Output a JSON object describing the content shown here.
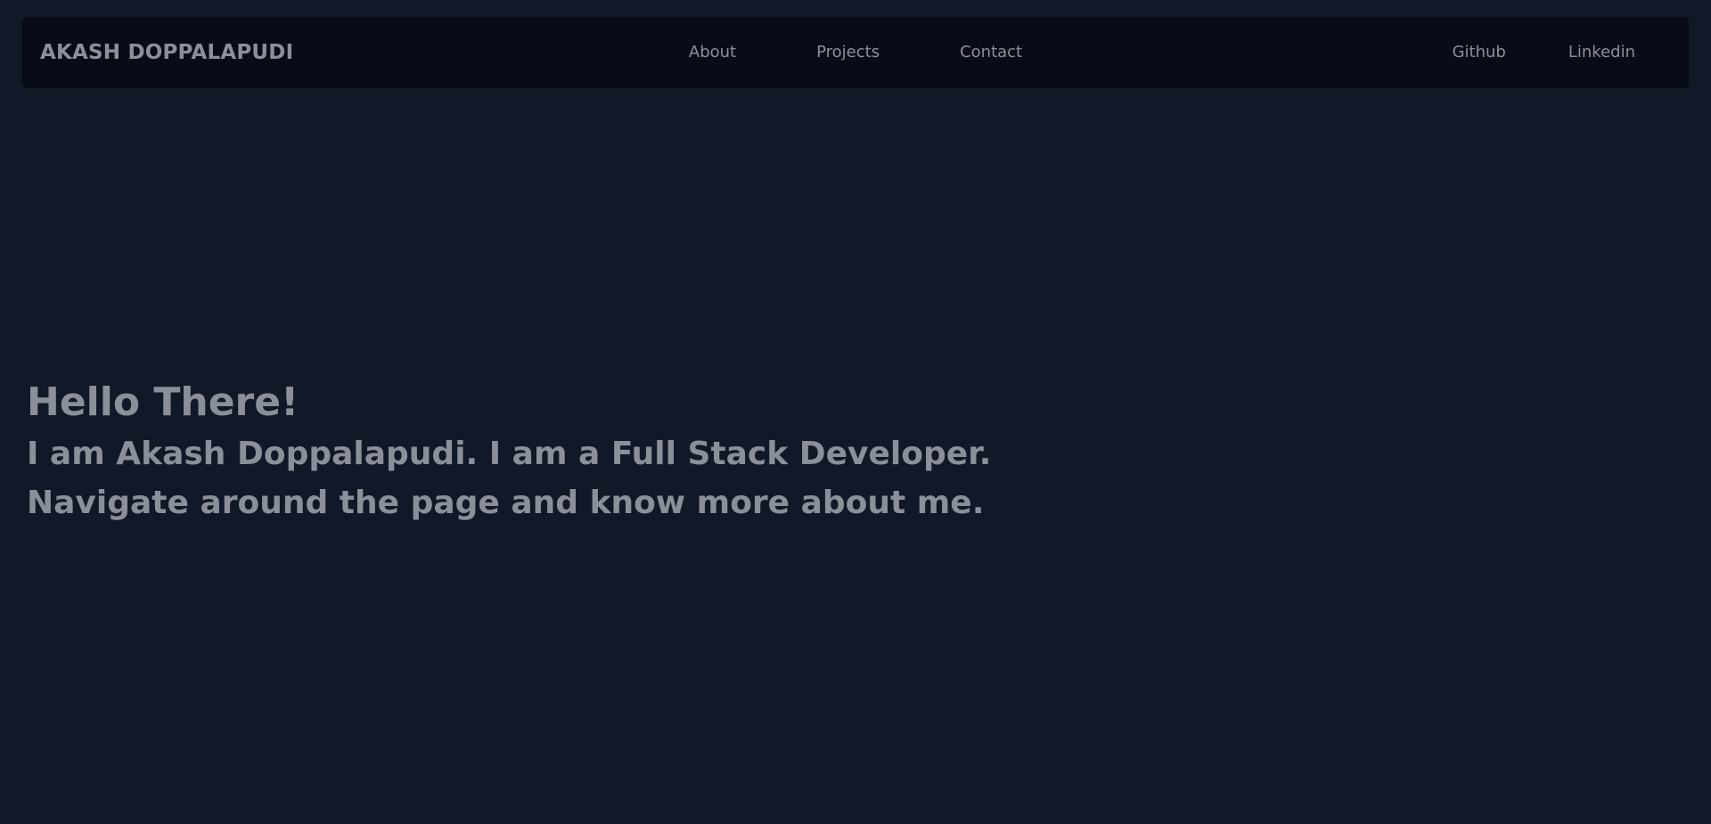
{
  "navbar": {
    "brand": "AKASH DOPPALAPUDI",
    "center_links": [
      {
        "label": "About"
      },
      {
        "label": "Projects"
      },
      {
        "label": "Contact"
      }
    ],
    "right_links": [
      {
        "label": "Github"
      },
      {
        "label": "Linkedin"
      }
    ]
  },
  "hero": {
    "title": "Hello There!",
    "line1": "I am Akash Doppalapudi. I am a Full Stack Developer.",
    "line2": "Navigate around the page and know more about me."
  },
  "colors": {
    "background": "#111827",
    "navbar": "#080c16",
    "text": "#8b8f99"
  }
}
